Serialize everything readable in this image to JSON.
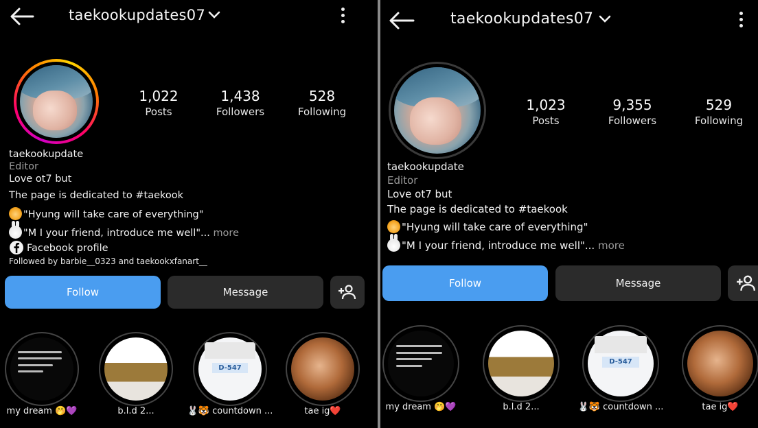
{
  "panels": [
    {
      "header": {
        "username": "taekookupdates07"
      },
      "stats": [
        {
          "value": "1,022",
          "label": "Posts"
        },
        {
          "value": "1,438",
          "label": "Followers"
        },
        {
          "value": "528",
          "label": "Following"
        }
      ],
      "bio": {
        "name": "taekookupdate",
        "category": "Editor",
        "lines": [
          "Love ot7 but",
          "The page is dedicated to #taekook"
        ],
        "quote1": "\"Hyung will take care of everything\"",
        "quote2": "\"M I your friend, introduce me well\"...",
        "more": "more",
        "facebook": "Facebook profile",
        "followed_by_prefix": "Followed by",
        "followed_by_user1": "barbie__0323",
        "followed_by_and": "and",
        "followed_by_user2": "taekookxfanart__"
      },
      "buttons": {
        "follow": "Follow",
        "message": "Message"
      },
      "highlights": [
        {
          "caption": "my dream 🤭💜"
        },
        {
          "caption": "b.l.d 2..."
        },
        {
          "caption": "🐰🐯 countdown ...",
          "card": "D-547"
        },
        {
          "caption": "tae ig❤️"
        }
      ]
    },
    {
      "header": {
        "username": "taekookupdates07"
      },
      "stats": [
        {
          "value": "1,023",
          "label": "Posts"
        },
        {
          "value": "9,355",
          "label": "Followers"
        },
        {
          "value": "529",
          "label": "Following"
        }
      ],
      "bio": {
        "name": "taekookupdate",
        "category": "Editor",
        "lines": [
          "Love ot7 but",
          "The page is dedicated to #taekook"
        ],
        "quote1": "\"Hyung will take care of everything\"",
        "quote2": "\"M I your friend, introduce me well\"...",
        "more": "more"
      },
      "buttons": {
        "follow": "Follow",
        "message": "Message"
      },
      "highlights": [
        {
          "caption": "my dream 🤭💜"
        },
        {
          "caption": "b.l.d 2..."
        },
        {
          "caption": "🐰🐯 countdown ...",
          "card": "D-547"
        },
        {
          "caption": "tae ig❤️"
        }
      ]
    }
  ],
  "icons": {
    "back": "arrow-left-icon",
    "dropdown": "chevron-down-icon",
    "menu": "kebab-menu-icon",
    "add_user": "add-person-icon",
    "facebook": "facebook-icon"
  },
  "colors": {
    "follow_button": "#4a9df0",
    "secondary_button": "#2b2b2b",
    "background": "#000000",
    "muted_text": "#9a9a9a"
  }
}
